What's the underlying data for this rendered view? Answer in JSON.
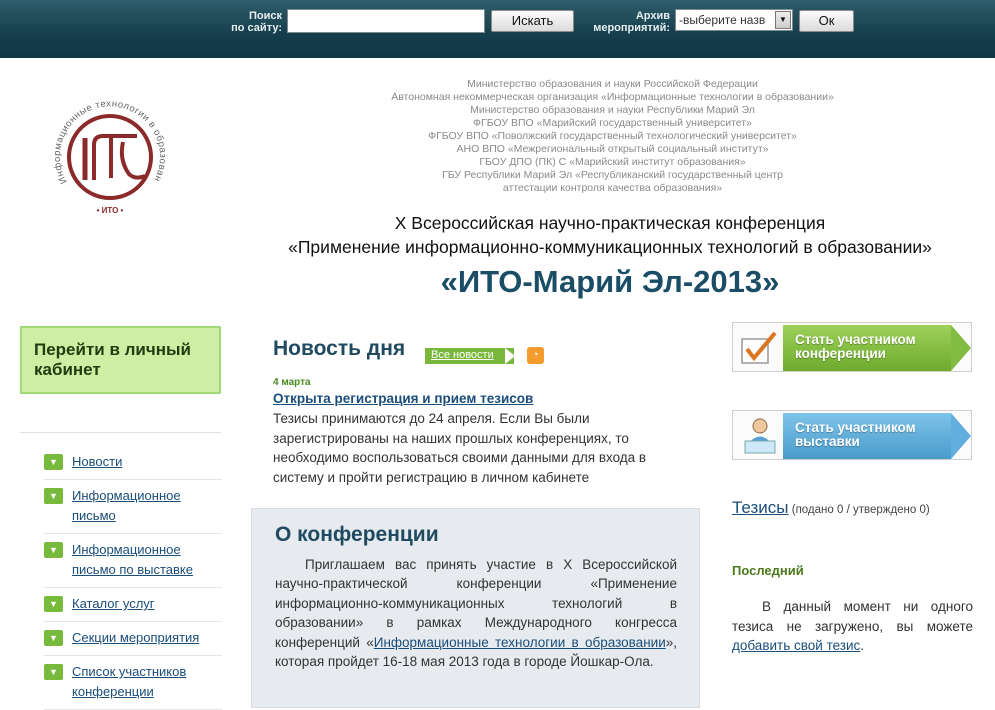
{
  "topbar": {
    "search_label_line1": "Поиск",
    "search_label_line2": "по сайту:",
    "search_value": "",
    "search_button": "Искать",
    "archive_label_line1": "Архив",
    "archive_label_line2": "мероприятий:",
    "archive_selected": "-выберите назв",
    "ok_button": "Ок"
  },
  "logo": {
    "arc_text": "Информационные технологии в образовании",
    "badge": "ИТО"
  },
  "organizations": [
    "Министерство образования и науки Российской Федерации",
    "Автономная некоммерческая организация «Информационные технологии в образовании»",
    "Министерство образования и науки Республики Марий Эл",
    "ФГБОУ ВПО «Марийский государственный университет»",
    "ФГБОУ ВПО «Поволжский государственный технологический университет»",
    "АНО ВПО «Межрегиональный открытый социальный институт»",
    "ГБОУ ДПО (ПК) С «Марийский институт образования»",
    "ГБУ Республики Марий Эл «Республиканский государственный центр",
    "аттестации контроля качества образования»"
  ],
  "conference": {
    "line1": "X Всероссийская научно-практическая конференция",
    "line2": "«Применение информационно-коммуникационных технологий в образовании»",
    "title": "«ИТО-Марий Эл-2013»"
  },
  "sidebar": {
    "cabinet_label": "Перейти в личный кабинет",
    "items": [
      {
        "label": "Новости"
      },
      {
        "label": "Информационное письмо"
      },
      {
        "label": "Информационное письмо по выставке"
      },
      {
        "label": "Каталог услуг"
      },
      {
        "label": "Секции мероприятия"
      },
      {
        "label": "Список участников конференции"
      }
    ]
  },
  "news": {
    "heading": "Новость дня",
    "all_news": "Все новости",
    "date": "4 марта",
    "title": "Открыта регистрация и прием тезисов",
    "body": "Тезисы принимаются до 24 апреля. Если Вы были зарегистрированы на наших прошлых конференциях, то необходимо воспользоваться своими данными для входа в систему и пройти регистрацию в личном кабинете"
  },
  "about": {
    "heading": "О конференции",
    "text_before": "Приглашаем вас принять участие в X Всероссийской научно-практической конференции «Применение информационно-коммуникационных технологий в образовании» в рамках Международного конгресса конференций «",
    "link": "Информационные технологии в образовании",
    "text_after": "», которая пройдет 16-18 мая 2013 года в городе Йошкар-Ола."
  },
  "right": {
    "participant_line1": "Стать участником",
    "participant_line2": "конференции",
    "exhibitor_line1": "Стать участником",
    "exhibitor_line2": "выставки",
    "theses_link": "Тезисы",
    "theses_status": "(подано 0 / утверждено 0)",
    "last_heading": "Последний",
    "last_text": "В данный момент ни одного тезиса не загружено, вы можете ",
    "last_link": "добавить свой тезис",
    "last_text_end": "."
  },
  "colors": {
    "topbar": "#153e4c",
    "title": "#1a4d66",
    "link": "#1a4d7a",
    "green": "#78bb3c",
    "cabinet_bg": "#ccefa4",
    "logo": "#8b2a2a"
  }
}
